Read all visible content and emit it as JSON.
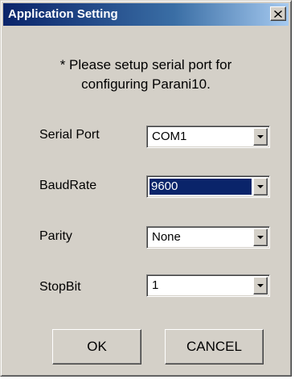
{
  "window": {
    "title": "Application Setting",
    "close_label": "X"
  },
  "instruction": {
    "line1": "* Please setup serial port for",
    "line2": "configuring Parani10."
  },
  "fields": {
    "serial_port": {
      "label": "Serial Port",
      "value": "COM1"
    },
    "baud_rate": {
      "label": "BaudRate",
      "value": "9600",
      "focused": true
    },
    "parity": {
      "label": "Parity",
      "value": "None"
    },
    "stop_bit": {
      "label": "StopBit",
      "value": "1"
    }
  },
  "buttons": {
    "ok_label": "OK",
    "cancel_label": "CANCEL"
  },
  "colors": {
    "dialog_face": "#d4d0c8",
    "titlebar_start": "#0a246a",
    "selection": "#0a246a"
  },
  "icons": {
    "close": "close-icon",
    "dropdown": "chevron-down-icon"
  }
}
